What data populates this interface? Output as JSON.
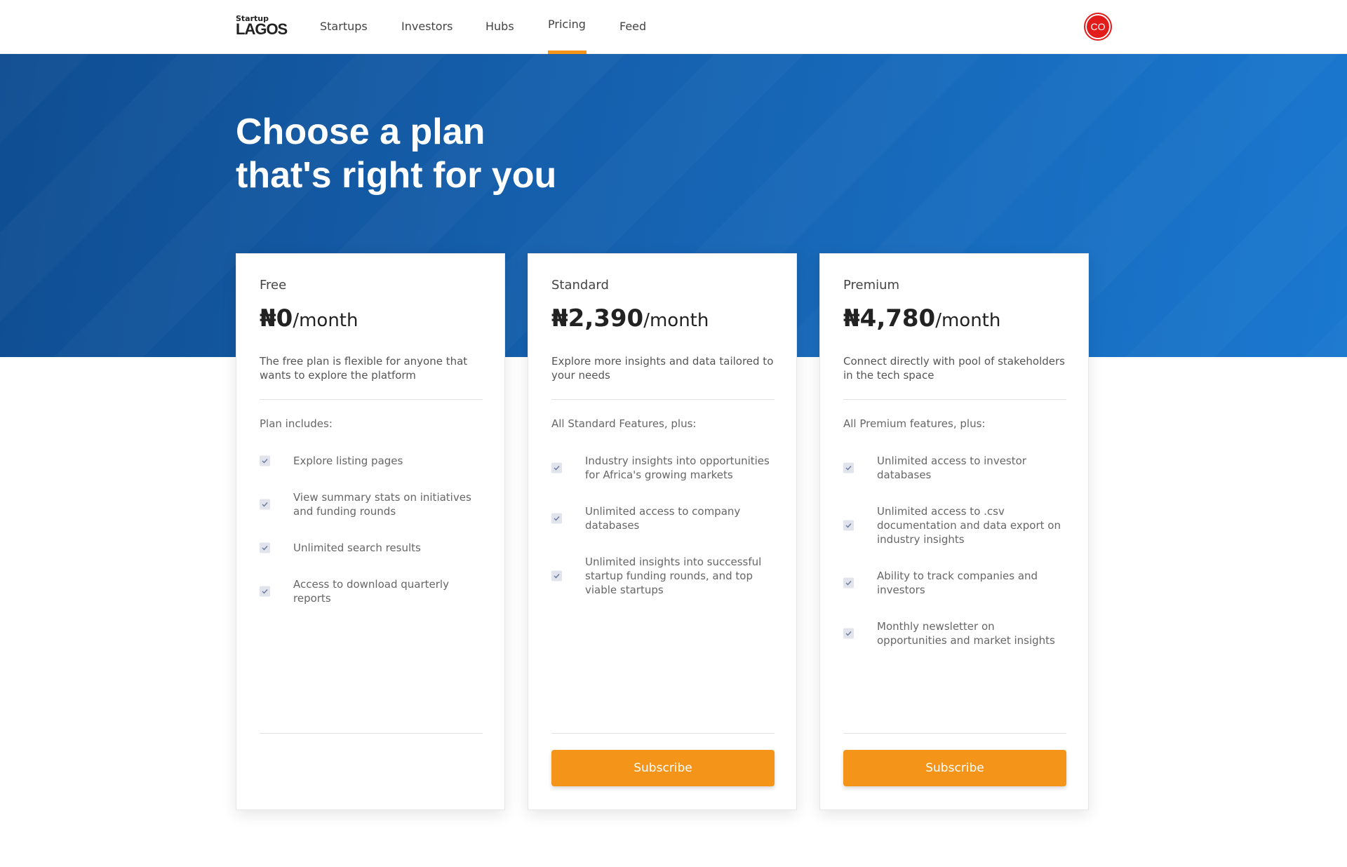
{
  "nav": {
    "logo_small": "Startup",
    "logo_big": "LAGOS",
    "links": [
      {
        "label": "Startups"
      },
      {
        "label": "Investors"
      },
      {
        "label": "Hubs"
      },
      {
        "label": "Pricing"
      },
      {
        "label": "Feed"
      }
    ],
    "active": "Pricing",
    "avatar_initials": "CO"
  },
  "hero": {
    "title_line1": "Choose a plan",
    "title_line2": "that's right for you"
  },
  "colors": {
    "accent": "#f49419",
    "hero": "#155fac",
    "avatar": "#e21b1b"
  },
  "plans": [
    {
      "name": "Free",
      "price": "₦0",
      "period": "/month",
      "description": "The free plan is flexible for anyone that wants to explore the platform",
      "includes": "Plan includes:",
      "features": [
        "Explore listing pages",
        "View summary stats on initiatives and funding rounds",
        "Unlimited search results",
        "Access to download quarterly reports"
      ]
    },
    {
      "name": "Standard",
      "price": "₦2,390",
      "period": "/month",
      "description": "Explore more insights and data tailored to your needs",
      "includes": "All Standard Features, plus:",
      "features": [
        "Industry insights into opportunities for Africa's growing markets",
        "Unlimited access to company databases",
        "Unlimited insights into successful startup funding rounds, and top viable startups"
      ],
      "button": "Subscribe"
    },
    {
      "name": "Premium",
      "price": "₦4,780",
      "period": "/month",
      "description": "Connect directly with pool of stakeholders in the tech space",
      "includes": "All Premium features, plus:",
      "features": [
        "Unlimited access to investor databases",
        "Unlimited access to .csv documentation and data export on industry insights",
        "Ability to track companies and investors",
        "Monthly newsletter on opportunities and market insights"
      ],
      "button": "Subscribe"
    }
  ]
}
